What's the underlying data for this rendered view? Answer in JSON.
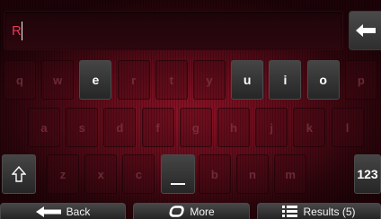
{
  "input": {
    "value": "R"
  },
  "keyboard": {
    "row1": [
      {
        "label": "q",
        "active": false
      },
      {
        "label": "w",
        "active": false
      },
      {
        "label": "e",
        "active": true
      },
      {
        "label": "r",
        "active": false
      },
      {
        "label": "t",
        "active": false
      },
      {
        "label": "y",
        "active": false
      },
      {
        "label": "u",
        "active": true
      },
      {
        "label": "i",
        "active": true
      },
      {
        "label": "o",
        "active": true
      },
      {
        "label": "p",
        "active": false
      }
    ],
    "row2": [
      {
        "label": "a",
        "active": false
      },
      {
        "label": "s",
        "active": false
      },
      {
        "label": "d",
        "active": false
      },
      {
        "label": "f",
        "active": false
      },
      {
        "label": "g",
        "active": false
      },
      {
        "label": "h",
        "active": false
      },
      {
        "label": "j",
        "active": false
      },
      {
        "label": "k",
        "active": false
      },
      {
        "label": "l",
        "active": false
      }
    ],
    "row3": [
      {
        "label": "z",
        "active": false
      },
      {
        "label": "x",
        "active": false
      },
      {
        "label": "c",
        "active": false
      },
      {
        "label": "v",
        "active": false
      },
      {
        "label": "b",
        "active": false
      },
      {
        "label": "n",
        "active": false
      },
      {
        "label": "m",
        "active": false
      }
    ],
    "numeric_key": "123",
    "shift_icon": "shift-arrow-icon",
    "space_icon": "space-bar-icon",
    "backspace_icon": "backspace-arrow-icon"
  },
  "bottom_bar": {
    "back": {
      "label": "Back",
      "icon": "arrow-left-icon"
    },
    "more": {
      "label": "More",
      "icon": "rounded-square-icon"
    },
    "results": {
      "label": "Results (5)",
      "icon": "list-icon"
    }
  },
  "colors": {
    "input_text": "#e23a56",
    "background": "#8e1326",
    "active_key": "#3a3a3a"
  }
}
